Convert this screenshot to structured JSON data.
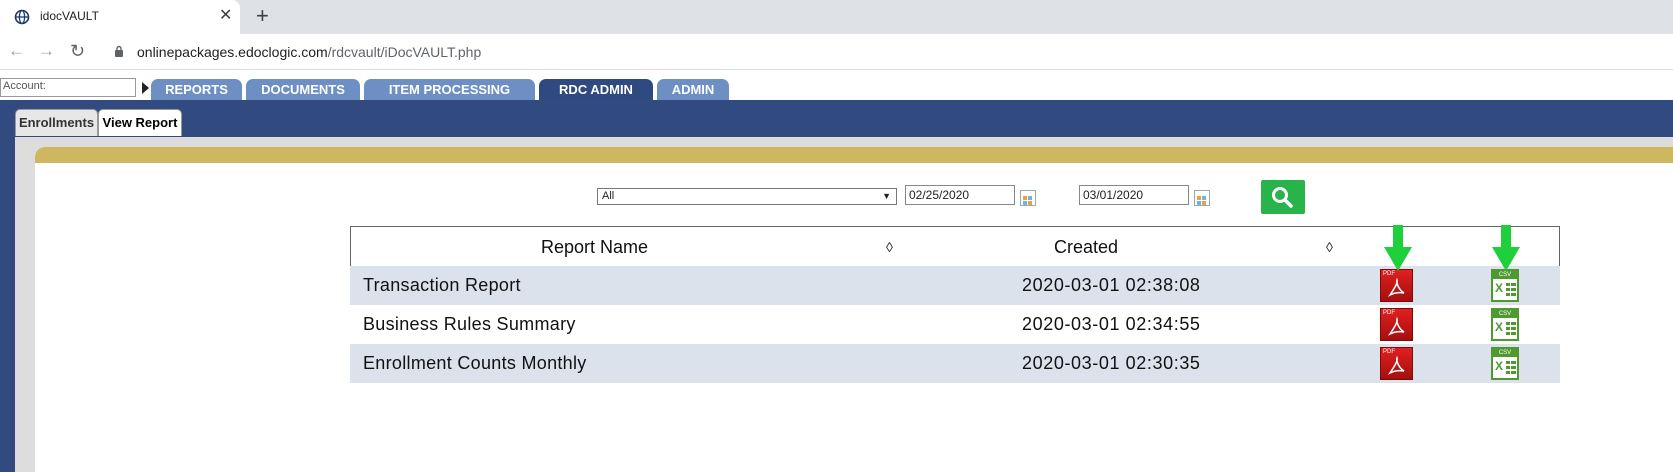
{
  "browser": {
    "tab_title": "idocVAULT",
    "url_host": "onlinepackages.edoclogic.com",
    "url_path": "/rdcvault/iDocVAULT.php"
  },
  "app": {
    "account_placeholder": "Account:",
    "nav_tabs": [
      "REPORTS",
      "DOCUMENTS",
      "ITEM PROCESSING",
      "RDC ADMIN",
      "ADMIN"
    ],
    "active_nav_tab": "RDC ADMIN",
    "sub_tabs": [
      "Enrollments",
      "View Report"
    ],
    "active_sub_tab": "View Report"
  },
  "filters": {
    "report_select": "All",
    "start_date": "02/25/2020",
    "end_date": "03/01/2020"
  },
  "table": {
    "columns": [
      "Report Name",
      "Created"
    ],
    "sort_glyph": "◊",
    "rows": [
      {
        "name": "Transaction Report",
        "created": "2020-03-01 02:38:08"
      },
      {
        "name": "Business Rules Summary",
        "created": "2020-03-01 02:34:55"
      },
      {
        "name": "Enrollment Counts Monthly",
        "created": "2020-03-01 02:30:35"
      }
    ],
    "pdf_icon_label": "PDF",
    "csv_icon_label": "CSV"
  },
  "colors": {
    "frame_blue": "#314a80",
    "nav_tab_blue": "#6d8fc4",
    "gold_band": "#cdb761",
    "search_green": "#28b34b",
    "row_alt": "#dbe2ec"
  }
}
